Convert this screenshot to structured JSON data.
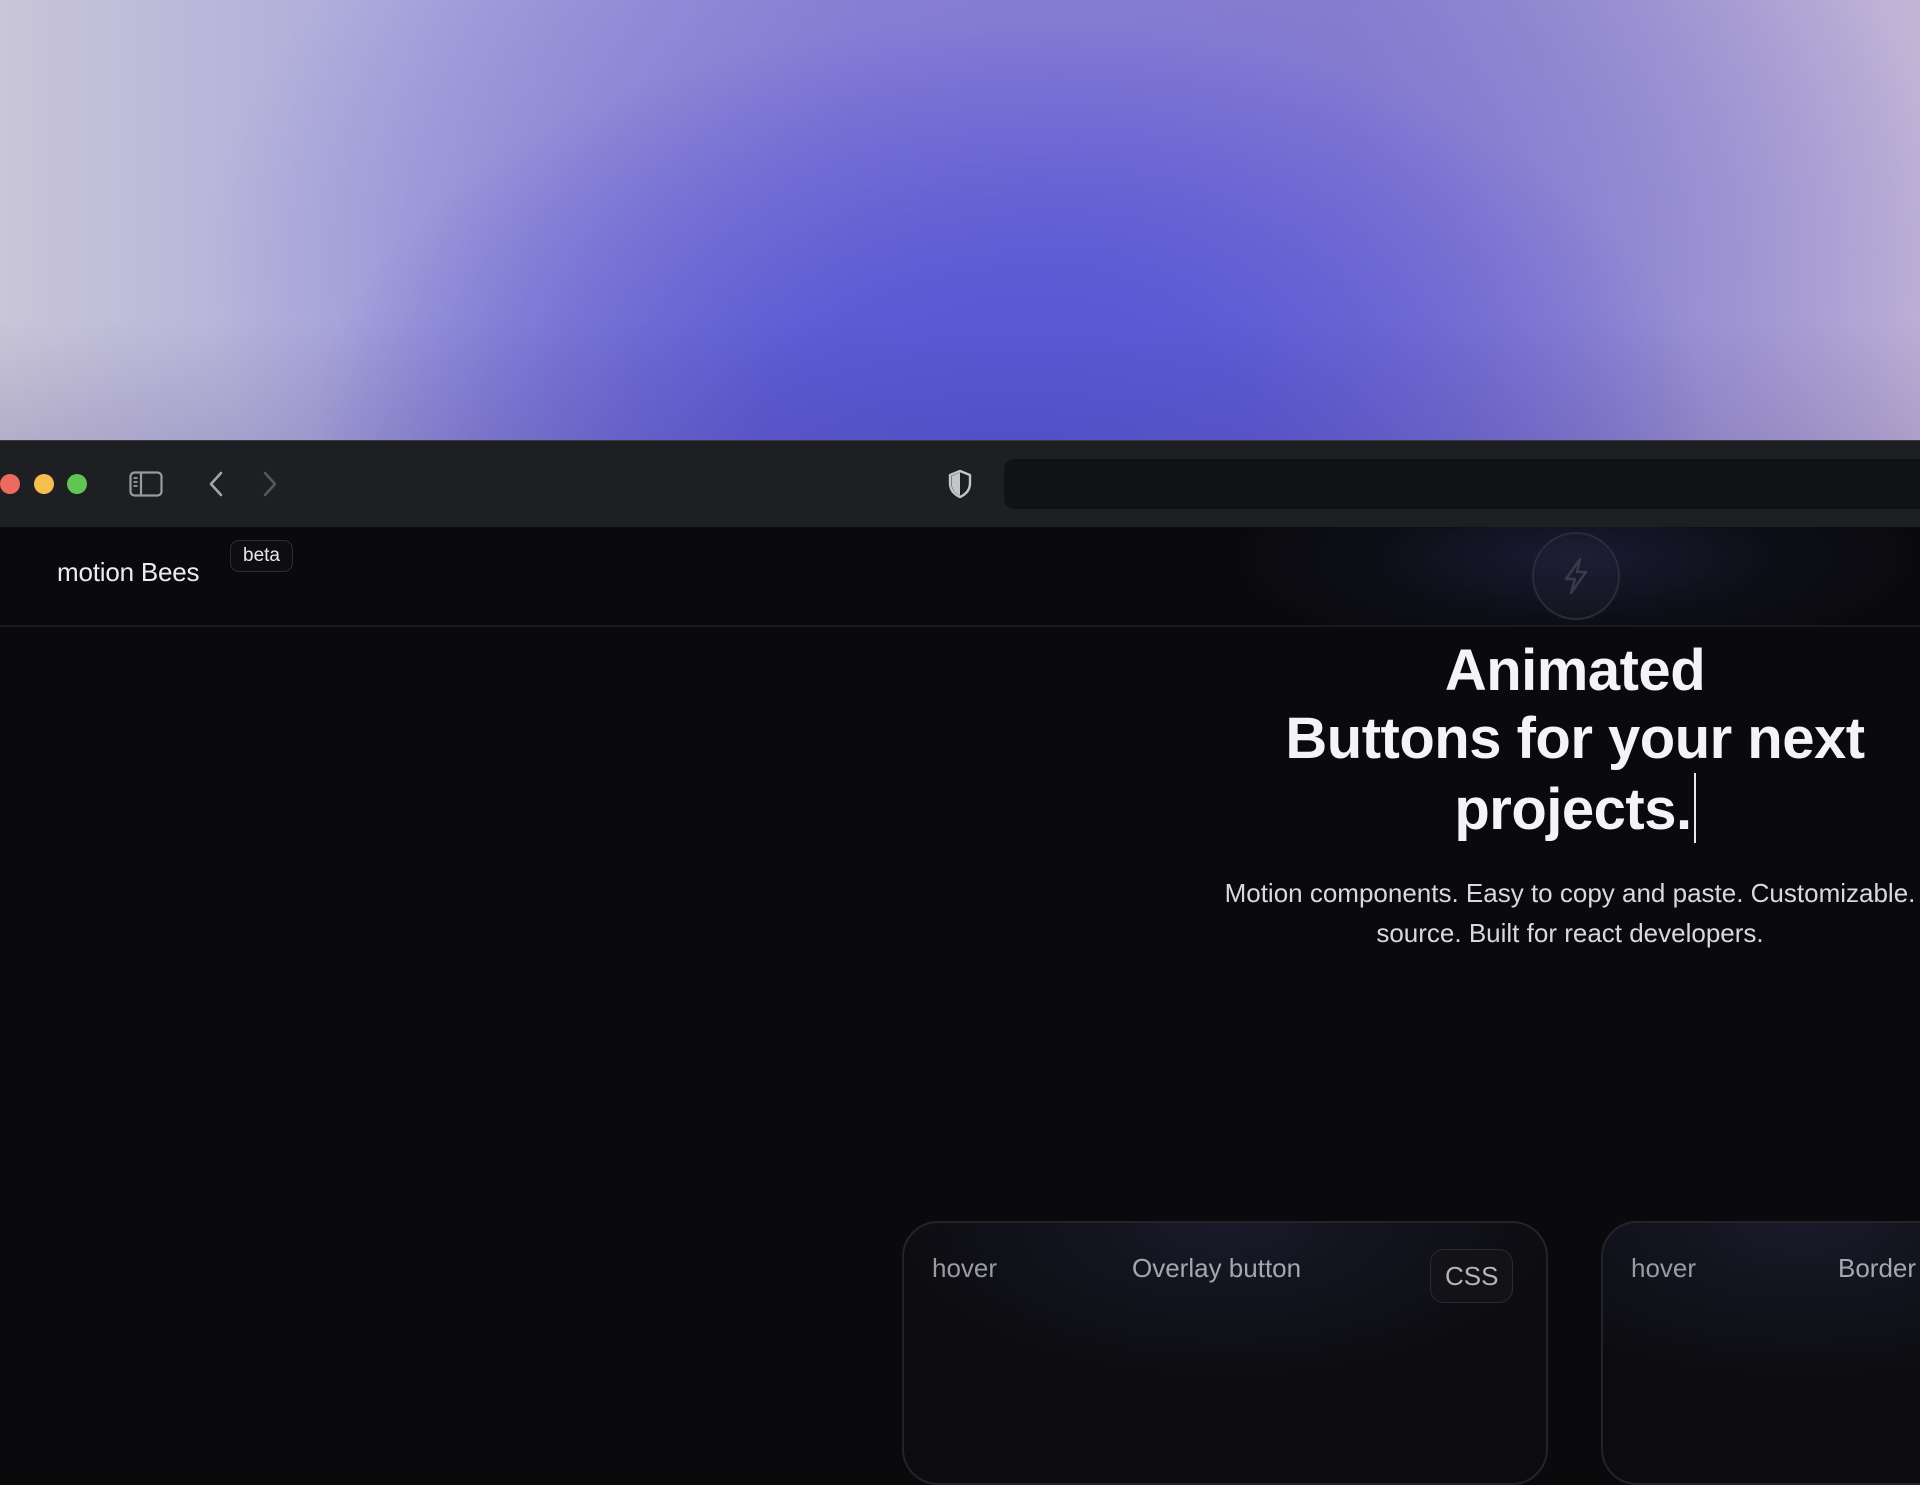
{
  "site": {
    "brand": "motion Bees",
    "badge": "beta"
  },
  "hero": {
    "headline_line1": "Animated",
    "headline_line2": "Buttons for your next",
    "headline_line3": "projects.",
    "subtitle_line1": "Motion components. Easy to copy and paste. Customizable.",
    "subtitle_line2": "source. Built for react developers."
  },
  "cards": [
    {
      "tag": "hover",
      "title": "Overlay button",
      "badge": "CSS"
    },
    {
      "tag": "hover",
      "title": "Border"
    }
  ],
  "icons": {
    "sidebar": "sidebar-toggle-icon",
    "back": "chevron-left-icon",
    "forward": "chevron-right-icon",
    "privacy": "shield-icon",
    "logo": "lightning-icon"
  },
  "colors": {
    "page_bg": "#0a0a0d",
    "toolbar_bg": "#1d1f23",
    "close": "#ed6a5e",
    "minimize": "#f4bf4f",
    "zoom": "#61c554"
  }
}
